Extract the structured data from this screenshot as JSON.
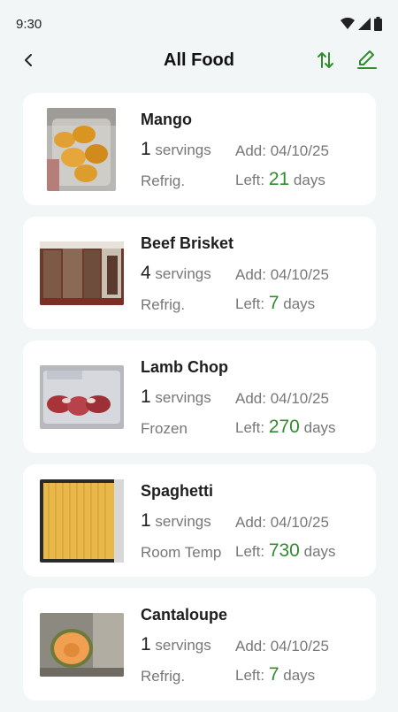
{
  "status": {
    "time": "9:30"
  },
  "header": {
    "title": "All Food"
  },
  "labels": {
    "servings": "servings",
    "add_prefix": "Add:",
    "left_prefix": "Left:",
    "days": "days"
  },
  "colors": {
    "accent": "#2e8b2e",
    "background": "#f3f6f6",
    "card": "#ffffff"
  },
  "items": [
    {
      "name": "Mango",
      "servings": "1",
      "added": "04/10/25",
      "storage": "Refrig.",
      "days_left": "21"
    },
    {
      "name": "Beef Brisket",
      "servings": "4",
      "added": "04/10/25",
      "storage": "Refrig.",
      "days_left": "7"
    },
    {
      "name": "Lamb Chop",
      "servings": "1",
      "added": "04/10/25",
      "storage": "Frozen",
      "days_left": "270"
    },
    {
      "name": "Spaghetti",
      "servings": "1",
      "added": "04/10/25",
      "storage": "Room Temp",
      "days_left": "730"
    },
    {
      "name": "Cantaloupe",
      "servings": "1",
      "added": "04/10/25",
      "storage": "Refrig.",
      "days_left": "7"
    }
  ]
}
